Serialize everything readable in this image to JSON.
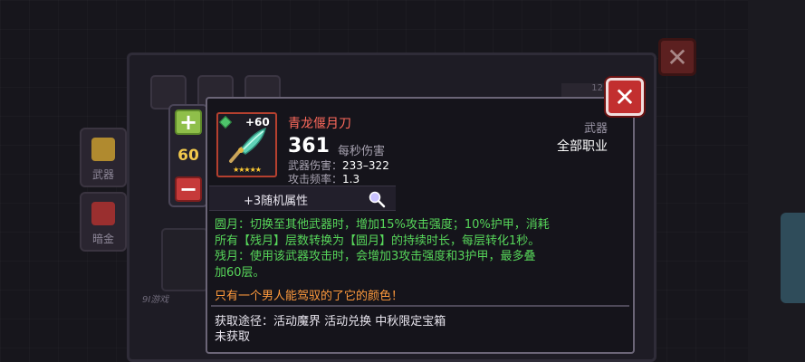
{
  "background": {
    "side_items": [
      {
        "label": "武器"
      },
      {
        "label": "暗金"
      }
    ],
    "watermark": "9I游戏",
    "counter": "12"
  },
  "stepper": {
    "plus_label": "+",
    "value": "60",
    "minus_label": "−"
  },
  "close_label": "✕",
  "weapon": {
    "name": "青龙偃月刀",
    "level_badge": "+60",
    "stars": "★★★★★",
    "dps": "361",
    "dps_label": "每秒伤害",
    "damage_label": "武器伤害：",
    "damage": "233–322",
    "rate_label": "攻击频率：",
    "rate": "1.3",
    "type": "武器",
    "class": "全部职业"
  },
  "affix": {
    "label": "+3随机属性"
  },
  "description_lines": [
    "圆月：切换至其他武器时，增加15%攻击强度；10%护甲，消耗",
    "所有【残月】层数转换为【圆月】的持续时长，每层转化1秒。",
    "残月：使用该武器攻击时，会增加3攻击强度和3护甲，最多叠",
    "加60层。"
  ],
  "flavor": "只有一个男人能驾驭的了它的颜色！",
  "source": "获取途径：活动魔界 活动兑换 中秋限定宝箱",
  "status": "未获取",
  "colors": {
    "name": "#ff6a5c",
    "desc": "#57d65a",
    "flavor": "#ff9a3c",
    "close": "#c22f2f"
  }
}
